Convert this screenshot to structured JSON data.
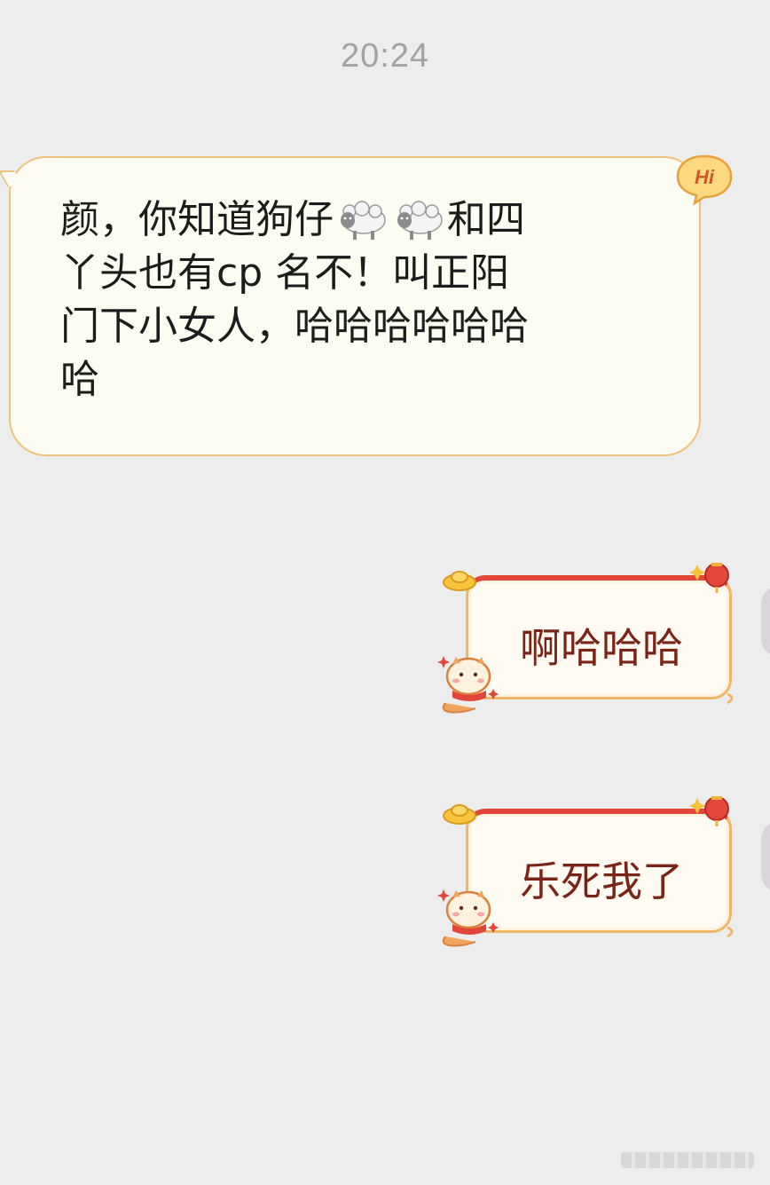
{
  "timestamp": "20:24",
  "incoming": {
    "line1_a": "颜，你知道狗仔",
    "emoji": "sheep-icon",
    "line1_b": "和四",
    "line2": "丫头也有cp 名不！叫正阳",
    "line3": "门下小女人，哈哈哈哈哈哈",
    "line4": "哈",
    "badge_text": "Hi"
  },
  "outgoing": [
    {
      "text": "啊哈哈哈"
    },
    {
      "text": "乐死我了"
    }
  ],
  "colors": {
    "background": "#ededed",
    "incoming_border": "#efc27a",
    "incoming_fill": "#fdfcf3",
    "outgoing_text": "#7a2418",
    "outgoing_top_border": "#e2463b"
  }
}
